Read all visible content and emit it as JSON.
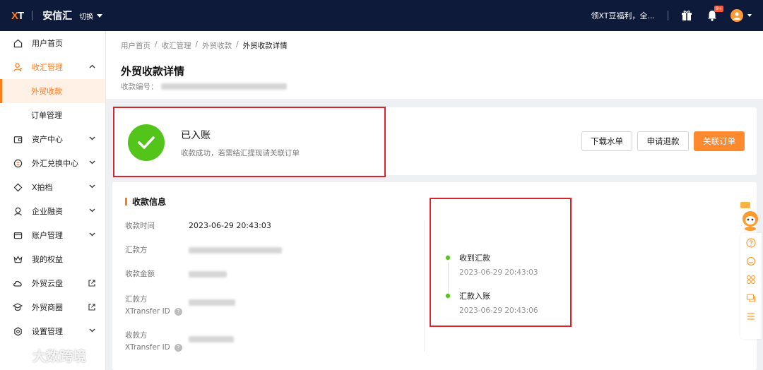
{
  "topbar": {
    "logo_x": "X",
    "logo_t": "T",
    "app_name": "安信汇",
    "switch_label": "切换",
    "promo_text": "领XT豆福利，全...",
    "badge_text": "9+"
  },
  "sidebar": {
    "items": [
      {
        "label": "用户首页",
        "icon": "home-icon"
      },
      {
        "label": "收汇管理",
        "icon": "user-receive-icon",
        "expanded": true
      },
      {
        "label": "外贸收款",
        "sub": true,
        "active": true
      },
      {
        "label": "订单管理",
        "sub": true
      },
      {
        "label": "资产中心",
        "icon": "wallet-icon"
      },
      {
        "label": "外汇兑换中心",
        "icon": "exchange-icon"
      },
      {
        "label": "X拍档",
        "icon": "diamond-icon"
      },
      {
        "label": "企业融资",
        "icon": "finance-icon"
      },
      {
        "label": "账户管理",
        "icon": "card-icon"
      },
      {
        "label": "我的权益",
        "icon": "crown-icon"
      },
      {
        "label": "外贸云盘",
        "icon": "cloud-icon",
        "external": true
      },
      {
        "label": "外贸商圈",
        "icon": "graduation-icon",
        "external": true
      },
      {
        "label": "设置管理",
        "icon": "settings-icon"
      }
    ]
  },
  "breadcrumb": [
    "用户首页",
    "收汇管理",
    "外贸收款",
    "外贸收款详情"
  ],
  "breadcrumb_sep": "/",
  "page": {
    "title": "外贸收款详情",
    "ref_label": "收款编号："
  },
  "status": {
    "title": "已入账",
    "description": "收款成功，若需结汇提现请关联订单",
    "buttons": {
      "download": "下载水单",
      "refund": "申请退款",
      "link_order": "关联订单"
    }
  },
  "info": {
    "section_title": "收款信息",
    "rows": {
      "time_label": "收款时间",
      "time_value": "2023-06-29 20:43:03",
      "payer_label": "汇款方",
      "amount_label": "收款金额",
      "payer_id_label_1": "汇款方",
      "payer_id_label_2": "XTransfer ID",
      "receiver_id_label_1": "收款方",
      "receiver_id_label_2": "XTransfer ID",
      "help_mark": "?"
    }
  },
  "timeline": [
    {
      "title": "收到汇款",
      "time": "2023-06-29 20:43:03"
    },
    {
      "title": "汇款入账",
      "time": "2023-06-29 20:43:06"
    }
  ],
  "watermark": "大数跨境",
  "colors": {
    "brand_orange": "#ff7a1a",
    "topbar_bg": "#0e1a3a",
    "success_green": "#52c41a",
    "highlight_red": "#d8242c"
  }
}
